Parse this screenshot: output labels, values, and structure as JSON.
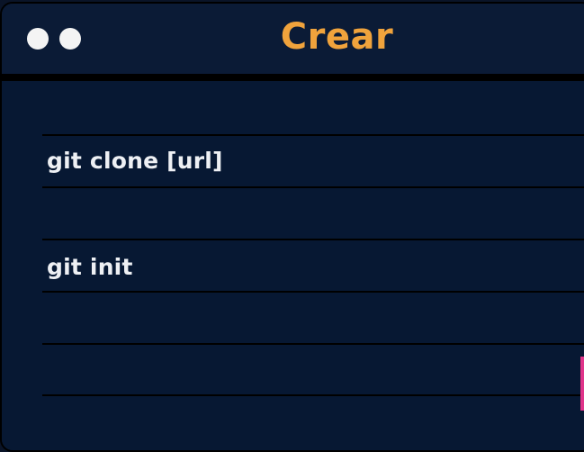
{
  "window": {
    "title": "Crear"
  },
  "commands": [
    {
      "label": "git clone [url]"
    },
    {
      "label": "git init"
    }
  ],
  "colors": {
    "title": "#f0a33c",
    "background": "#071833",
    "text": "#eef0f4",
    "window_dots": "#f4f4f4"
  }
}
